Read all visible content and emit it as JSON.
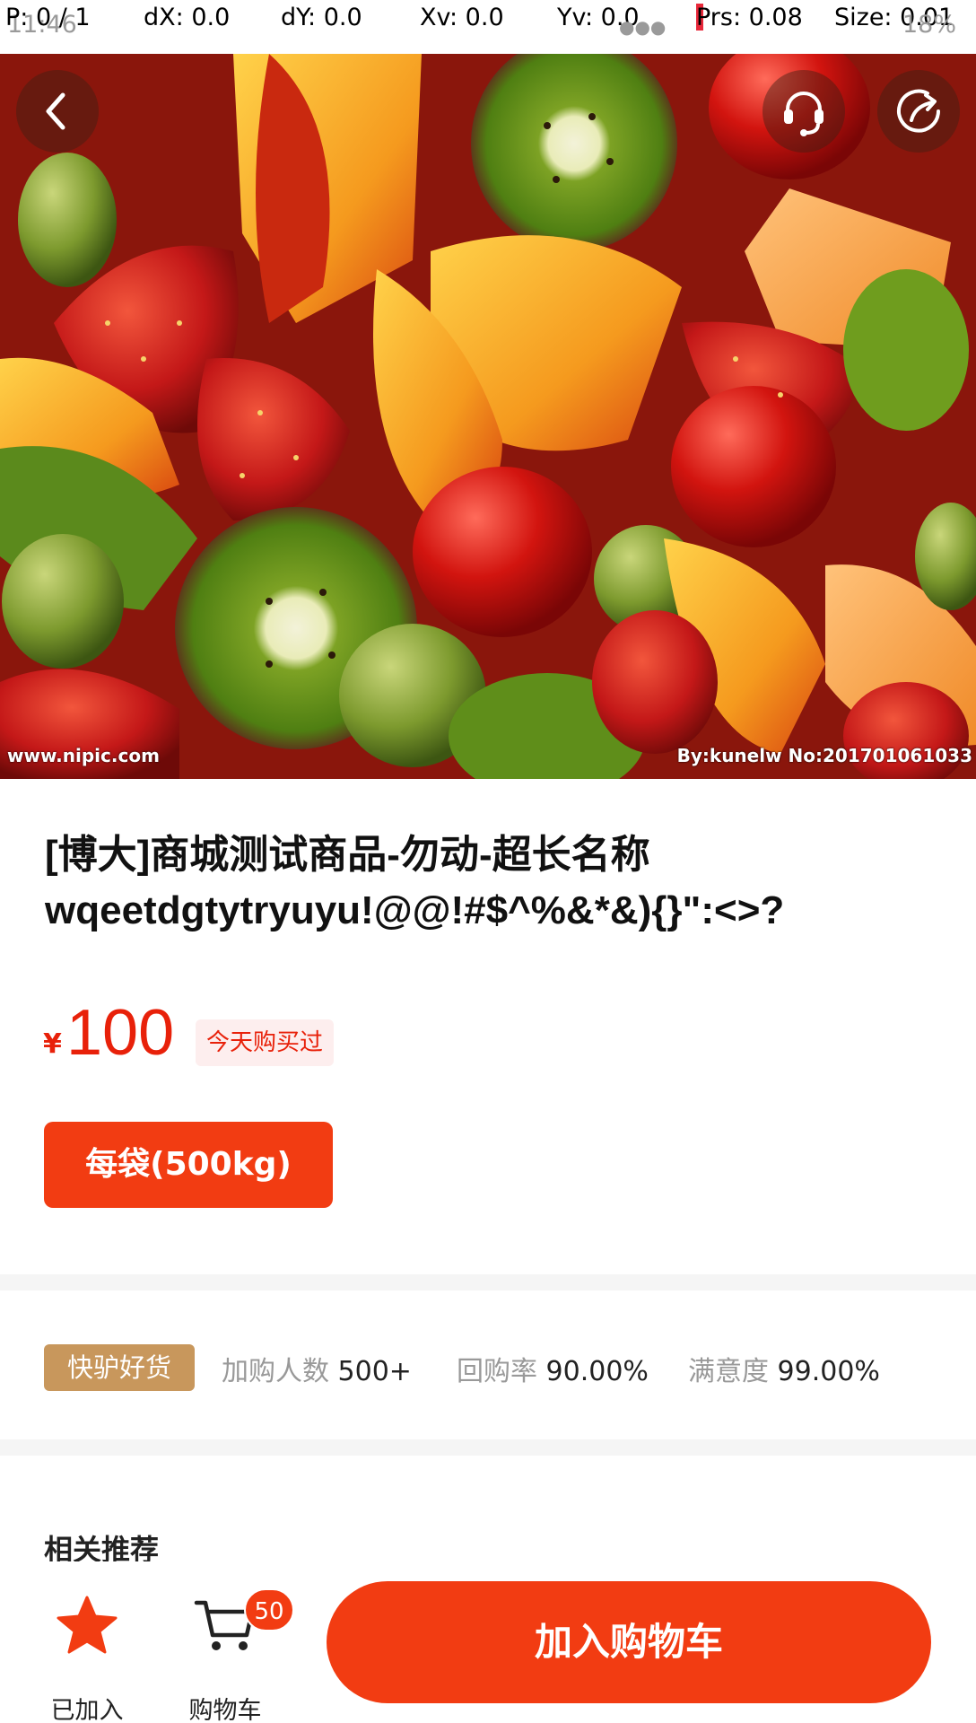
{
  "status_bar": {
    "p": "P: 0 / 1",
    "dx": "dX: 0.0",
    "dy": "dY: 0.0",
    "xv": "Xv: 0.0",
    "yv": "Yv: 0.0",
    "prs": "Prs: 0.08",
    "size": "Size: 0.01",
    "time": "11:46",
    "battery": "18%"
  },
  "hero": {
    "watermark_left": "www.nipic.com",
    "watermark_right": "By:kunelw No:201701061033"
  },
  "nav": {
    "back_icon": "chevron-left-icon",
    "service_icon": "headset-icon",
    "share_icon": "share-icon"
  },
  "product": {
    "title_line1": "[博大]商城测试商品-勿动-超长名称",
    "title_line2": "wqeetdgtytryuyu!@@!#$^%&*&){}\":<>?",
    "price_symbol": "¥",
    "price": "100",
    "bought_tag": "今天购买过",
    "spec": "每袋(500kg)"
  },
  "stats": {
    "badge": "快驴好货",
    "items": [
      {
        "label": "加购人数",
        "value": "500+"
      },
      {
        "label": "回购率",
        "value": "90.00%"
      },
      {
        "label": "满意度",
        "value": "99.00%"
      }
    ]
  },
  "related": {
    "title": "相关推荐"
  },
  "bottom": {
    "favorite_label": "已加入",
    "cart_label": "购物车",
    "cart_count": "50",
    "add_to_cart": "加入购物车"
  },
  "colors": {
    "accent": "#f23c12",
    "price": "#e8210a",
    "badge_gold": "#c8975c"
  }
}
